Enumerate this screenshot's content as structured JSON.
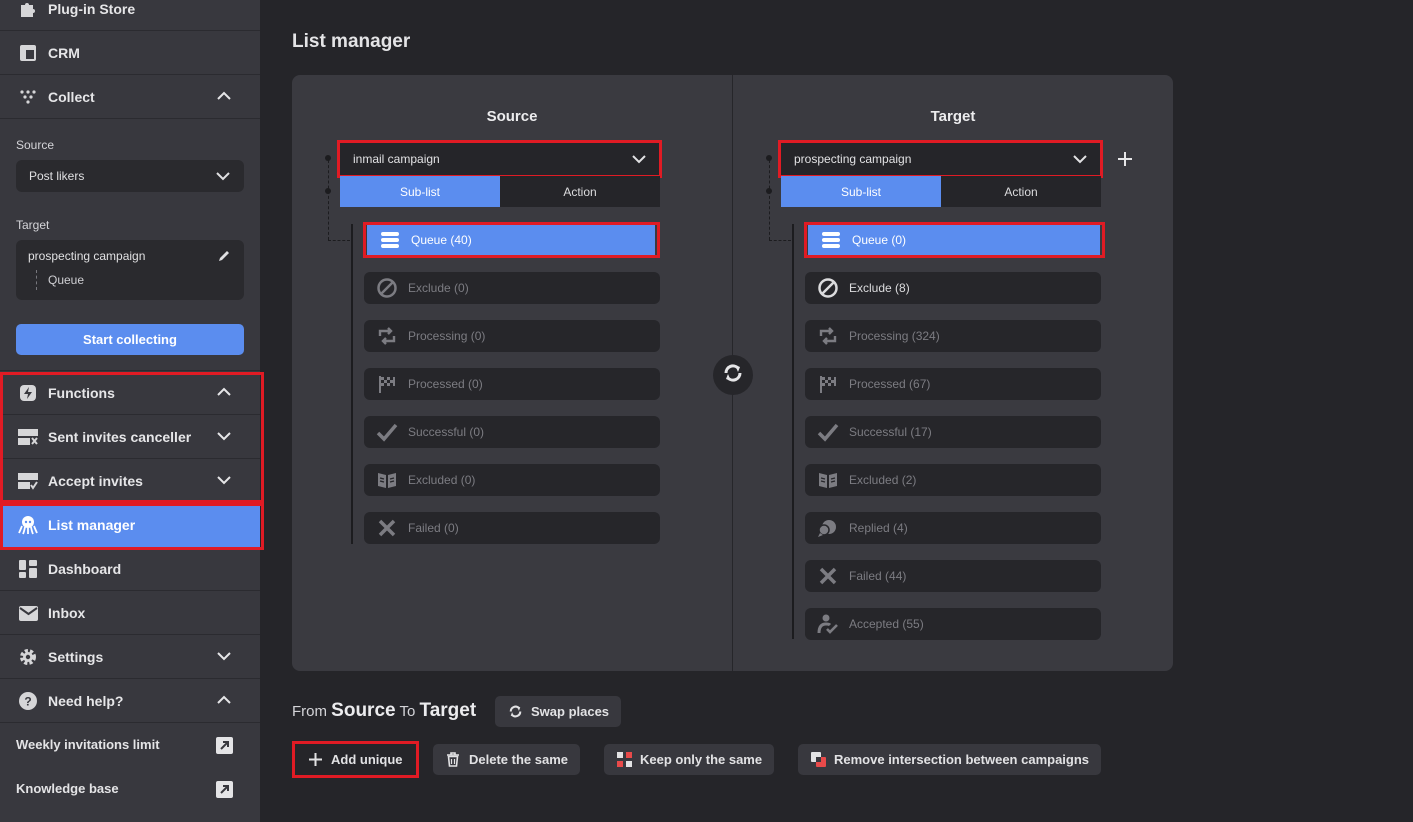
{
  "sidebar": {
    "plugin_store": "Plug-in Store",
    "crm": "CRM",
    "collect": "Collect",
    "source_label": "Source",
    "source_value": "Post likers",
    "target_label": "Target",
    "target_campaign": "prospecting campaign",
    "target_sublist": "Queue",
    "start_collecting": "Start collecting",
    "functions": "Functions",
    "sent_invites_canceller": "Sent invites canceller",
    "accept_invites": "Accept invites",
    "list_manager": "List manager",
    "dashboard": "Dashboard",
    "inbox": "Inbox",
    "settings": "Settings",
    "need_help": "Need help?",
    "weekly_invitations_limit": "Weekly invitations limit",
    "knowledge_base": "Knowledge base"
  },
  "main": {
    "title": "List manager",
    "source": {
      "title": "Source",
      "campaign": "inmail campaign",
      "tab_sublist": "Sub-list",
      "tab_action": "Action",
      "rows": [
        "Queue (40)",
        "Exclude (0)",
        "Processing (0)",
        "Processed (0)",
        "Successful (0)",
        "Excluded (0)",
        "Failed (0)"
      ]
    },
    "target": {
      "title": "Target",
      "campaign": "prospecting campaign",
      "tab_sublist": "Sub-list",
      "tab_action": "Action",
      "rows": [
        "Queue (0)",
        "Exclude (8)",
        "Processing (324)",
        "Processed (67)",
        "Successful (17)",
        "Excluded (2)",
        "Replied (4)",
        "Failed (44)",
        "Accepted (55)"
      ]
    },
    "from_word": "From",
    "from_source": "Source",
    "to_word": "To",
    "to_target": "Target",
    "swap_places": "Swap places",
    "actions": {
      "add_unique": "Add unique",
      "delete_same": "Delete the same",
      "keep_only_same": "Keep only the same",
      "remove_intersection": "Remove intersection between campaigns"
    }
  },
  "colors": {
    "accent": "#5b8def",
    "highlight_border": "#e01b24",
    "background": "#252529",
    "sidebar": "#38383e",
    "panel": "#3a3a40"
  },
  "icons": {
    "queue": "stack-icon",
    "exclude": "ban-icon",
    "processing": "cycle-icon",
    "processed": "checkered-flag-icon",
    "successful": "check-icon",
    "excluded": "book-icon",
    "replied": "chat-bubbles-icon",
    "failed": "x-icon",
    "accepted": "person-check-icon"
  }
}
